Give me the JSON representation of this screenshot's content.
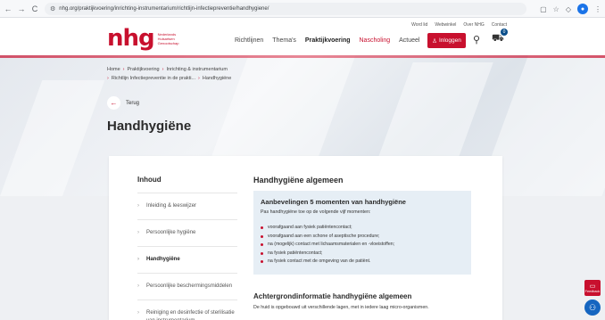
{
  "browser": {
    "url": "nhg.org/praktijkvoering/inrichting-instrumentarium/richtlijn-infectiepreventie/handhygiene/",
    "back": "←",
    "forward": "→",
    "reload": "C"
  },
  "header": {
    "top_links": [
      "Word lid",
      "Webwinkel",
      "Over NHG",
      "Contact"
    ],
    "logo": {
      "mark": "nhg",
      "text": "Nederlands Huisartsen Genootschap"
    },
    "nav": [
      "Richtlijnen",
      "Thema's",
      "Praktijkvoering",
      "Nascholing",
      "Actueel"
    ],
    "active_nav": "Praktijkvoering",
    "login_label": "Inloggen",
    "cart_count": "0",
    "brand_color": "#c8102e"
  },
  "breadcrumb": {
    "line1": [
      "Home",
      "Praktijkvoering",
      "Inrichting & instrumentarium"
    ],
    "line2": [
      "Richtlijn Infectiepreventie in de prakti...",
      "Handhygiëne"
    ]
  },
  "back_label": "Terug",
  "page_title": "Handhygiëne",
  "sidebar": {
    "title": "Inhoud",
    "items": [
      {
        "label": "Inleiding & leeswijzer"
      },
      {
        "label": "Persoonlijke hygiëne"
      },
      {
        "label": "Handhygiëne"
      },
      {
        "label": "Persoonlijke beschermingsmiddelen"
      },
      {
        "label": "Reiniging en desinfectie of sterilisatie van instrumentarium"
      }
    ],
    "active_index": 2
  },
  "main": {
    "heading": "Handhygiëne algemeen",
    "box": {
      "title": "Aanbevelingen 5 momenten van handhygiëne",
      "intro": "Pas handhygiëne toe op de volgende vijf momenten:",
      "items": [
        "voorafgaand aan fysiek patiëntencontact;",
        "voorafgaand aan een schone of aseptische procedure;",
        "na (mogelijk) contact met lichaamsmaterialen en -vloeistoffen;",
        "na fysiek patiëntencontact;",
        "na fysiek contact met de omgeving van de patiënt."
      ]
    },
    "subheading": "Achtergrondinformatie handhygiëne algemeen",
    "body": "De huid is opgebouwd uit verschillende lagen, met in iedere laag micro-organismen."
  },
  "feedback_label": "Feedback"
}
